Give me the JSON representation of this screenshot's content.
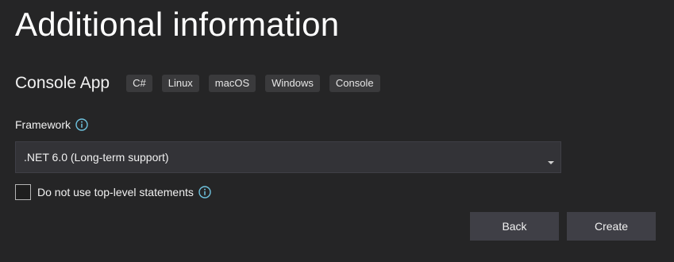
{
  "header": {
    "title": "Additional information"
  },
  "template": {
    "name": "Console App",
    "tags": [
      "C#",
      "Linux",
      "macOS",
      "Windows",
      "Console"
    ]
  },
  "framework": {
    "label": "Framework",
    "info_icon": "info-circle-icon",
    "selected": ".NET 6.0 (Long-term support)",
    "dropdown_icon": "caret-down-icon"
  },
  "top_level_statements": {
    "label": "Do not use top-level statements",
    "checked": false,
    "info_icon": "info-circle-icon"
  },
  "buttons": {
    "back_label": "Back",
    "create_label": "Create"
  },
  "colors": {
    "background": "#252526",
    "tag_background": "#3a3a3c",
    "button_background": "#3f3f46",
    "info_accent": "#6fc3df"
  }
}
